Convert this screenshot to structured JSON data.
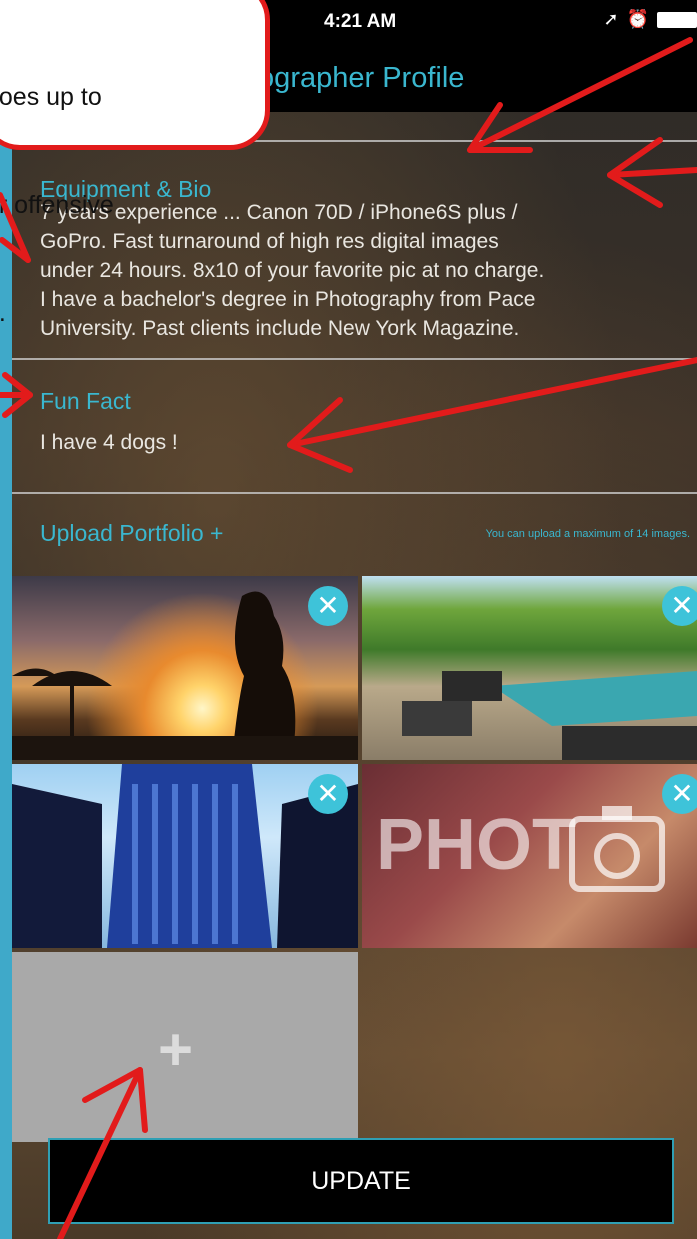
{
  "status_bar": {
    "time": "4:21 AM",
    "icons": [
      "location-arrow-icon",
      "alarm-icon",
      "battery-icon"
    ]
  },
  "nav": {
    "title": "tographer Profile"
  },
  "equipment": {
    "label": "Equipment & Bio",
    "lines": [
      "7 years experience ... Canon 70D / iPhone6S plus /",
      "GoPro.  Fast turnaround of high res digital images",
      "under 24 hours.  8x10 of your favorite pic at no charge.",
      "I have a bachelor's degree in Photography from Pace",
      "University. Past clients include New York Magazine."
    ]
  },
  "fun_fact": {
    "label": "Fun Fact",
    "text": "I have 4 dogs !"
  },
  "portfolio": {
    "label": "Upload Portfolio +",
    "note": "You can upload a maximum of 14 images."
  },
  "photos": [
    {
      "name": "sunset-photo"
    },
    {
      "name": "pool-patio-photo"
    },
    {
      "name": "skyscraper-photo"
    },
    {
      "name": "photo-session-graphic",
      "caption": "PHOT"
    }
  ],
  "add_tile_label": "+",
  "update_label": "UPDATE",
  "callout": {
    "lines": [
      "goes up to",
      "or offensive",
      "d."
    ]
  },
  "colors": {
    "accent": "#3ab7cf",
    "arrow": "#e21b1b",
    "frame": "#3fa9c9"
  }
}
